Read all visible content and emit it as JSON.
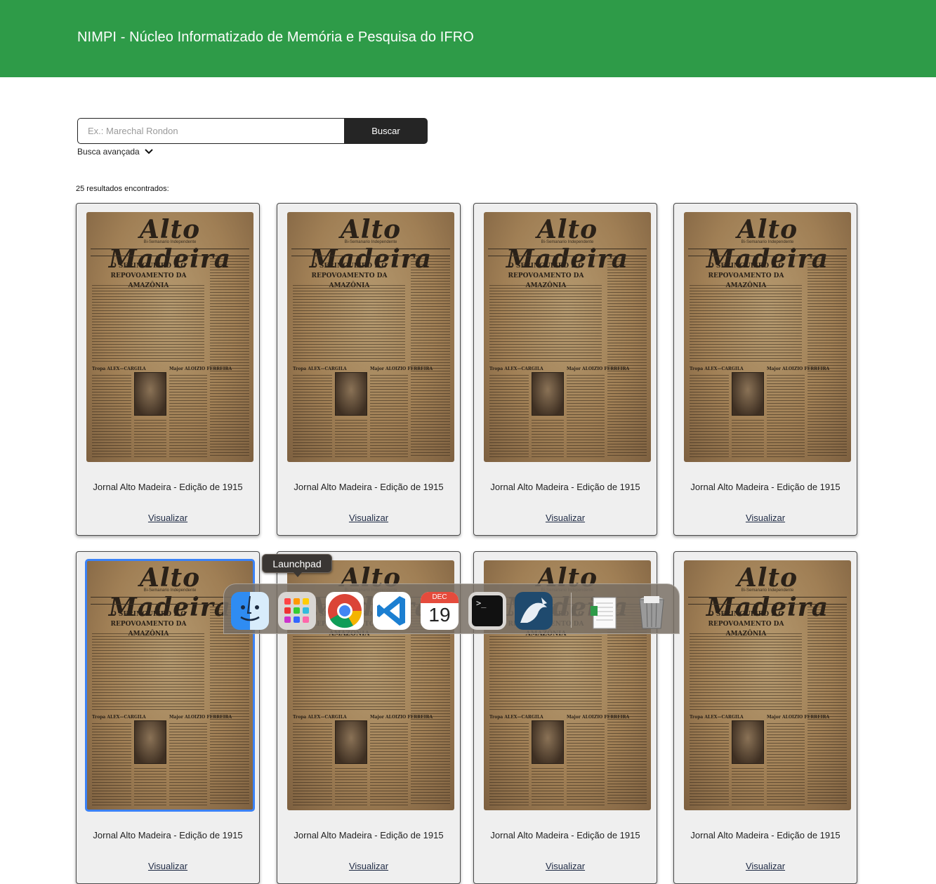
{
  "header": {
    "title": "NIMPI - Núcleo Informatizado de Memória e Pesquisa do IFRO"
  },
  "search": {
    "placeholder": "Ex.: Marechal Rondon",
    "value": "",
    "button_label": "Buscar"
  },
  "advanced_search": {
    "label": "Busca avançada"
  },
  "results": {
    "count_text": "25 resultados encontrados:",
    "cards": [
      {
        "title": "Jornal Alto Madeira - Edição de 1915",
        "link": "Visualizar"
      },
      {
        "title": "Jornal Alto Madeira - Edição de 1915",
        "link": "Visualizar"
      },
      {
        "title": "Jornal Alto Madeira - Edição de 1915",
        "link": "Visualizar"
      },
      {
        "title": "Jornal Alto Madeira - Edição de 1915",
        "link": "Visualizar"
      },
      {
        "title": "Jornal Alto Madeira - Edição de 1915",
        "link": "Visualizar"
      },
      {
        "title": "Jornal Alto Madeira - Edição de 1915",
        "link": "Visualizar"
      },
      {
        "title": "Jornal Alto Madeira - Edição de 1915",
        "link": "Visualizar"
      },
      {
        "title": "Jornal Alto Madeira - Edição de 1915",
        "link": "Visualizar"
      }
    ]
  },
  "newspaper": {
    "masthead": "Alto Madeira",
    "subtitle": "Bi-Semanario Independente",
    "headline": "O SERINGUEIRO E O REPOVOAMENTO DA AMAZÔNIA"
  },
  "dock": {
    "tooltip": "Launchpad",
    "calendar_month": "DEC",
    "calendar_day": "19",
    "items": [
      "finder-icon",
      "launchpad-icon",
      "chrome-icon",
      "vscode-icon",
      "calendar-icon",
      "terminal-icon",
      "mysql-workbench-icon",
      "document-icon",
      "trash-icon"
    ]
  },
  "colors": {
    "header": "#2e9b48",
    "button": "#252525",
    "card_bg": "#efefef"
  }
}
